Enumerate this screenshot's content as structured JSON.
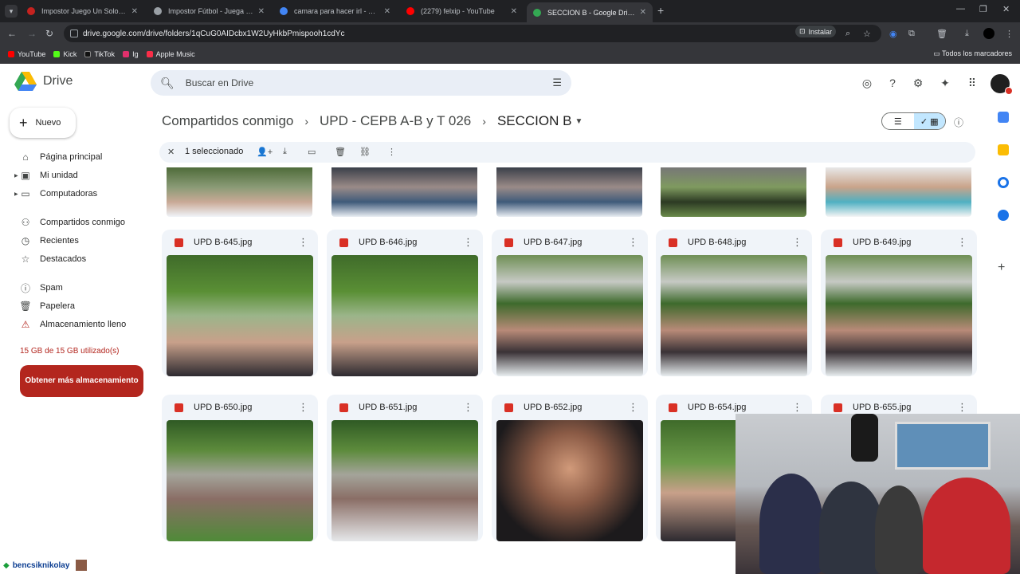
{
  "browser": {
    "tabs": [
      {
        "title": "Impostor Juego Un Solo Dispositivo",
        "fav": "#e8eaed"
      },
      {
        "title": "Impostor Fútbol - Juega con amigos",
        "fav": "#9aa0a6"
      },
      {
        "title": "camara para hacer irl - Buscar con Google",
        "fav": "#4285f4"
      },
      {
        "title": "(2279) felxip - YouTube",
        "fav": "#ff0000"
      },
      {
        "title": "SECCION B - Google Drive",
        "fav": "#34a853"
      }
    ],
    "url": "drive.google.com/drive/folders/1qCuG0AIDcbx1W2UyHkbPmispooh1cdYc",
    "install_label": "Instalar",
    "bookmarks": [
      {
        "label": "YouTube",
        "color": "#ff0000"
      },
      {
        "label": "Kick",
        "color": "#53fc18"
      },
      {
        "label": "TikTok",
        "color": "#111111"
      },
      {
        "label": "Ig",
        "color": "#e1306c"
      },
      {
        "label": "Apple Music",
        "color": "#fa2d48"
      }
    ],
    "all_bookmarks": "Todos los marcadores"
  },
  "drive": {
    "app_name": "Drive",
    "search_placeholder": "Buscar en Drive",
    "new_button": "Nuevo",
    "sidebar": [
      {
        "label": "Página principal",
        "icon": "home-icon",
        "glyph": "⌂"
      },
      {
        "label": "Mi unidad",
        "icon": "my-drive-icon",
        "glyph": "▣"
      },
      {
        "label": "Computadoras",
        "icon": "computer-icon",
        "glyph": "▭"
      },
      {
        "label": "Compartidos conmigo",
        "icon": "shared-icon",
        "glyph": "👥"
      },
      {
        "label": "Recientes",
        "icon": "clock-icon",
        "glyph": "◷"
      },
      {
        "label": "Destacados",
        "icon": "star-icon",
        "glyph": "☆"
      },
      {
        "label": "Spam",
        "icon": "spam-icon",
        "glyph": "ⓘ"
      },
      {
        "label": "Papelera",
        "icon": "trash-icon",
        "glyph": "🗑"
      },
      {
        "label": "Almacenamiento lleno",
        "icon": "warning-icon",
        "glyph": "⚠"
      }
    ],
    "storage_text": "15 GB de 15 GB utilizado(s)",
    "get_storage_button": "Obtener más almacenamiento",
    "breadcrumb": [
      "Compartidos conmigo",
      "UPD - CEPB A-B y T 026",
      "SECCION B"
    ],
    "selection": {
      "count_label": "1 seleccionado"
    },
    "files_row1": [
      "UPD B-645.jpg",
      "UPD B-646.jpg",
      "UPD B-647.jpg",
      "UPD B-648.jpg",
      "UPD B-649.jpg"
    ],
    "files_row2": [
      "UPD B-650.jpg",
      "UPD B-651.jpg",
      "UPD B-652.jpg",
      "UPD B-654.jpg",
      "UPD B-655.jpg"
    ]
  },
  "overlay": {
    "chat_user": "bencsiknikolay"
  }
}
